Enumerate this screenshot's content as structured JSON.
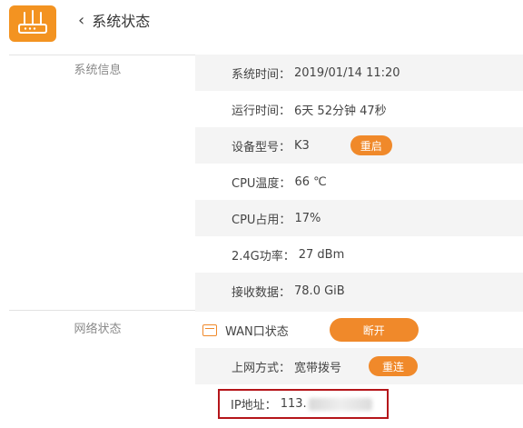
{
  "header": {
    "title": "系统状态",
    "back_symbol": "‹"
  },
  "sections": {
    "system_info": "系统信息",
    "network_status": "网络状态"
  },
  "system_rows": [
    {
      "label": "系统时间：",
      "value": "2019/01/14 11:20"
    },
    {
      "label": "运行时间：",
      "value": "6天 52分钟 47秒"
    },
    {
      "label": "设备型号：",
      "value": "K3"
    },
    {
      "label": "CPU温度：",
      "value": "66 ℃"
    },
    {
      "label": "CPU占用：",
      "value": "17%"
    },
    {
      "label": "2.4G功率：",
      "value": "27 dBm"
    },
    {
      "label": "接收数据：",
      "value": "78.0 GiB"
    }
  ],
  "buttons": {
    "restart": "重启",
    "disconnect": "断开",
    "reconnect": "重连"
  },
  "network": {
    "wan_label": "WAN口状态",
    "mode_label": "上网方式：",
    "mode_value": "宽带拨号",
    "ip_label": "IP地址：",
    "ip_value": "113."
  },
  "colors": {
    "accent": "#f39321",
    "button": "#f0892a",
    "highlight_border": "#b5151a",
    "panel_bg": "#f4f4f4"
  }
}
